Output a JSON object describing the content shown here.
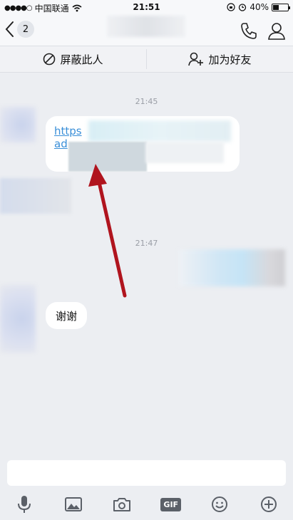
{
  "status_bar": {
    "signal": "●●●●○",
    "carrier": "中国联通",
    "time": "21:51",
    "battery": "40%",
    "battery_level": 0.4
  },
  "nav": {
    "back_count": "2"
  },
  "actions": {
    "block_label": "屏蔽此人",
    "add_friend_label": "加为好友"
  },
  "messages": {
    "timestamp_1": "21:45",
    "link_text_line1": "https",
    "link_text_line2": "ad",
    "timestamp_2": "21:47",
    "thanks_text": "谢谢"
  },
  "icons": {
    "back": "chevron-left-icon",
    "phone": "phone-icon",
    "profile": "person-icon",
    "block": "block-icon",
    "add_friend": "add-person-icon",
    "mic": "microphone-icon",
    "image": "image-icon",
    "camera": "camera-icon",
    "emoji": "emoji-icon",
    "plus": "plus-circle-icon"
  },
  "toolbar": {
    "gif_label": "GIF"
  },
  "colors": {
    "arrow": "#b0141e",
    "link": "#3a8fd8"
  }
}
